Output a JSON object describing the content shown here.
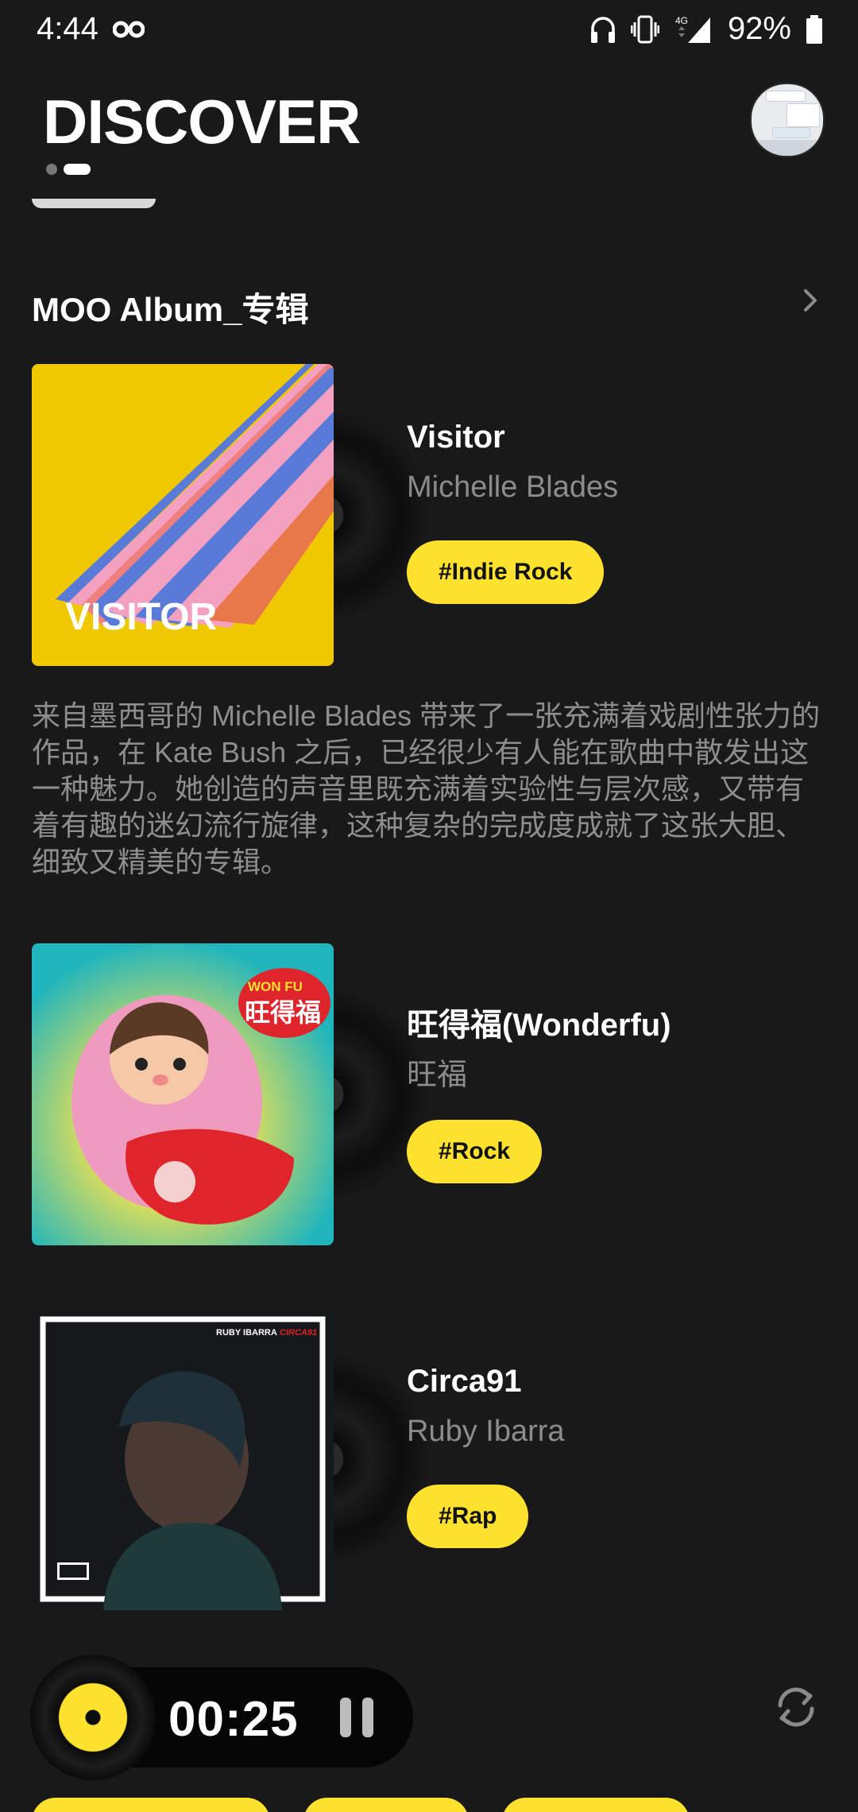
{
  "status_bar": {
    "time": "4:44",
    "network": "4G",
    "battery": "92%"
  },
  "header": {
    "title": "DISCOVER"
  },
  "section": {
    "title": "MOO Album_专辑"
  },
  "albums": [
    {
      "title": "Visitor",
      "artist": "Michelle Blades",
      "tag": "#Indie Rock",
      "cover_text": "VISITOR"
    },
    {
      "title": "旺得福(Wonderfu)",
      "artist": "旺福",
      "tag": "#Rock",
      "cover_text": "WON FU",
      "cover_text_cn": "旺得福"
    },
    {
      "title": "Circa91",
      "artist": "Ruby Ibarra",
      "tag": "#Rap",
      "cover_artist": "RUBY IBARRA",
      "cover_title": "CIRCA91"
    }
  ],
  "description": "来自墨西哥的 Michelle Blades 带来了一张充满着戏剧性张力的作品，在 Kate Bush 之后，已经很少有人能在歌曲中散发出这一种魅力。她创造的声音里既充满着实验性与层次感，又带有着有趣的迷幻流行旋律，这种复杂的完成度成就了这张大胆、细致又精美的专辑。",
  "player": {
    "time": "00:25"
  },
  "colors": {
    "background": "#191919",
    "accent": "#ffe22e",
    "muted_text": "#8c8c8c"
  }
}
